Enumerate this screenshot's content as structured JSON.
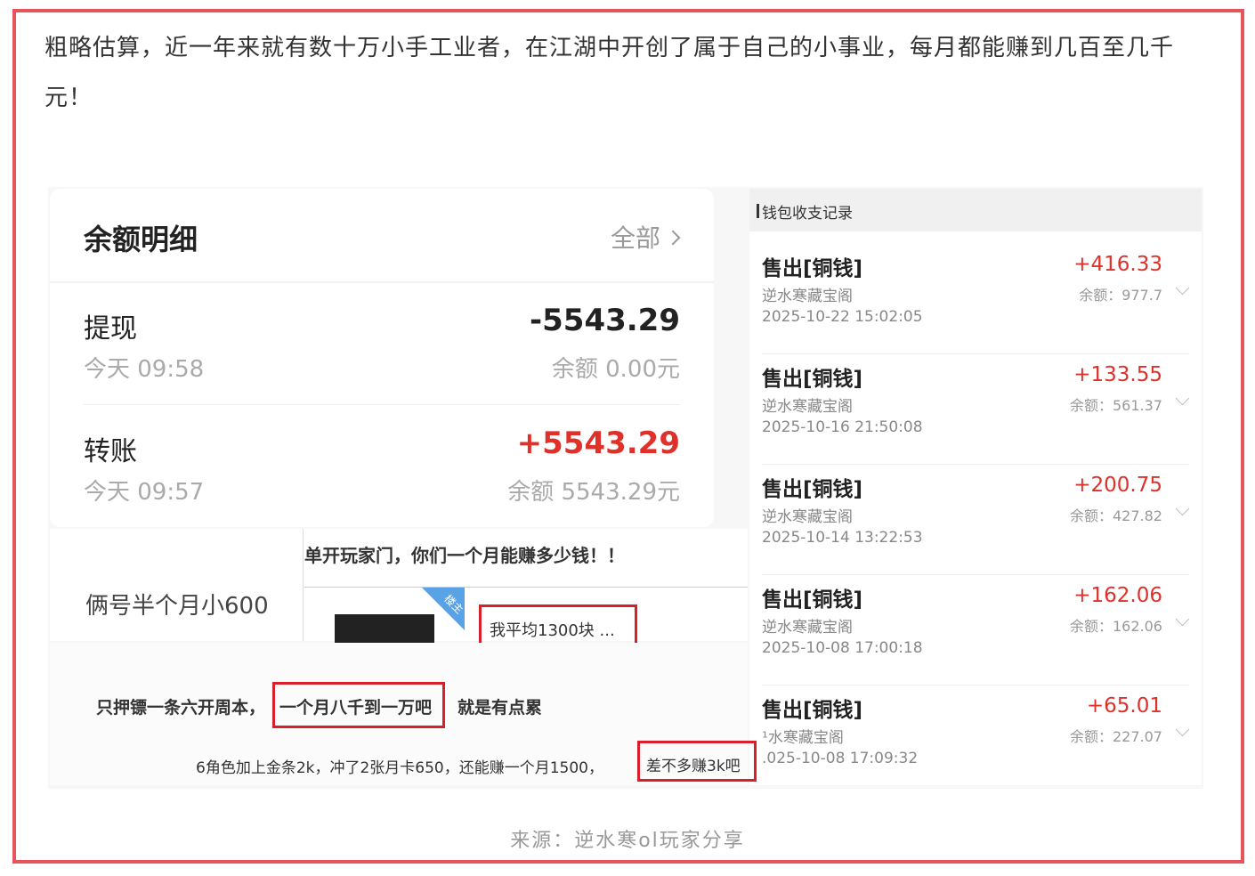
{
  "intro_text": "粗略估算，近一年来就有数十万小手工业者，在江湖中开创了属于自己的小事业，每月都能赚到几百至几千元！",
  "balance_card": {
    "title": "余额明细",
    "all_label": "全部",
    "rows": [
      {
        "name": "提现",
        "time": "今天 09:58",
        "amount": "-5543.29",
        "balance": "余额 0.00元",
        "amount_color": "#222222"
      },
      {
        "name": "转账",
        "time": "今天 09:57",
        "amount": "+5543.29",
        "balance": "余额 5543.29元",
        "amount_color": "#e0302a"
      }
    ]
  },
  "ledger": {
    "header": "钱包收支记录",
    "entries": [
      {
        "title": "售出[铜钱]",
        "shop": "逆水寒藏宝阁",
        "date": "2025-10-22 15:02:05",
        "amount": "+416.33",
        "balance": "余额：977.7"
      },
      {
        "title": "售出[铜钱]",
        "shop": "逆水寒藏宝阁",
        "date": "2025-10-16 21:50:08",
        "amount": "+133.55",
        "balance": "余额：561.37"
      },
      {
        "title": "售出[铜钱]",
        "shop": "逆水寒藏宝阁",
        "date": "2025-10-14 13:22:53",
        "amount": "+200.75",
        "balance": "余额：427.82"
      },
      {
        "title": "售出[铜钱]",
        "shop": "逆水寒藏宝阁",
        "date": "2025-10-08 17:00:18",
        "amount": "+162.06",
        "balance": "余额：162.06"
      },
      {
        "title": "售出[铜钱]",
        "shop": "¹水寒藏宝阁",
        "date": ".025-10-08 17:09:32",
        "amount": "+65.01",
        "balance": "余额：227.07"
      }
    ]
  },
  "chats": {
    "question": "单开玩家门，你们一个月能赚多少钱！！",
    "half_month": "俩号半个月小600",
    "avg": "我平均1300块 ...",
    "badge": "楼主",
    "line1_a": "只押镖一条六开周本，",
    "line1_b": "一个月八千到一万吧",
    "line1_c": "就是有点累",
    "line2_a": "6角色加上金条2k，冲了2张月卡650，还能赚一个月1500，",
    "line2_b": "差不多赚3k吧"
  },
  "caption": "来源：逆水寒ol玩家分享",
  "colors": {
    "frame": "#e8545b",
    "highlight": "#d9202a",
    "positive": "#e0302a"
  }
}
